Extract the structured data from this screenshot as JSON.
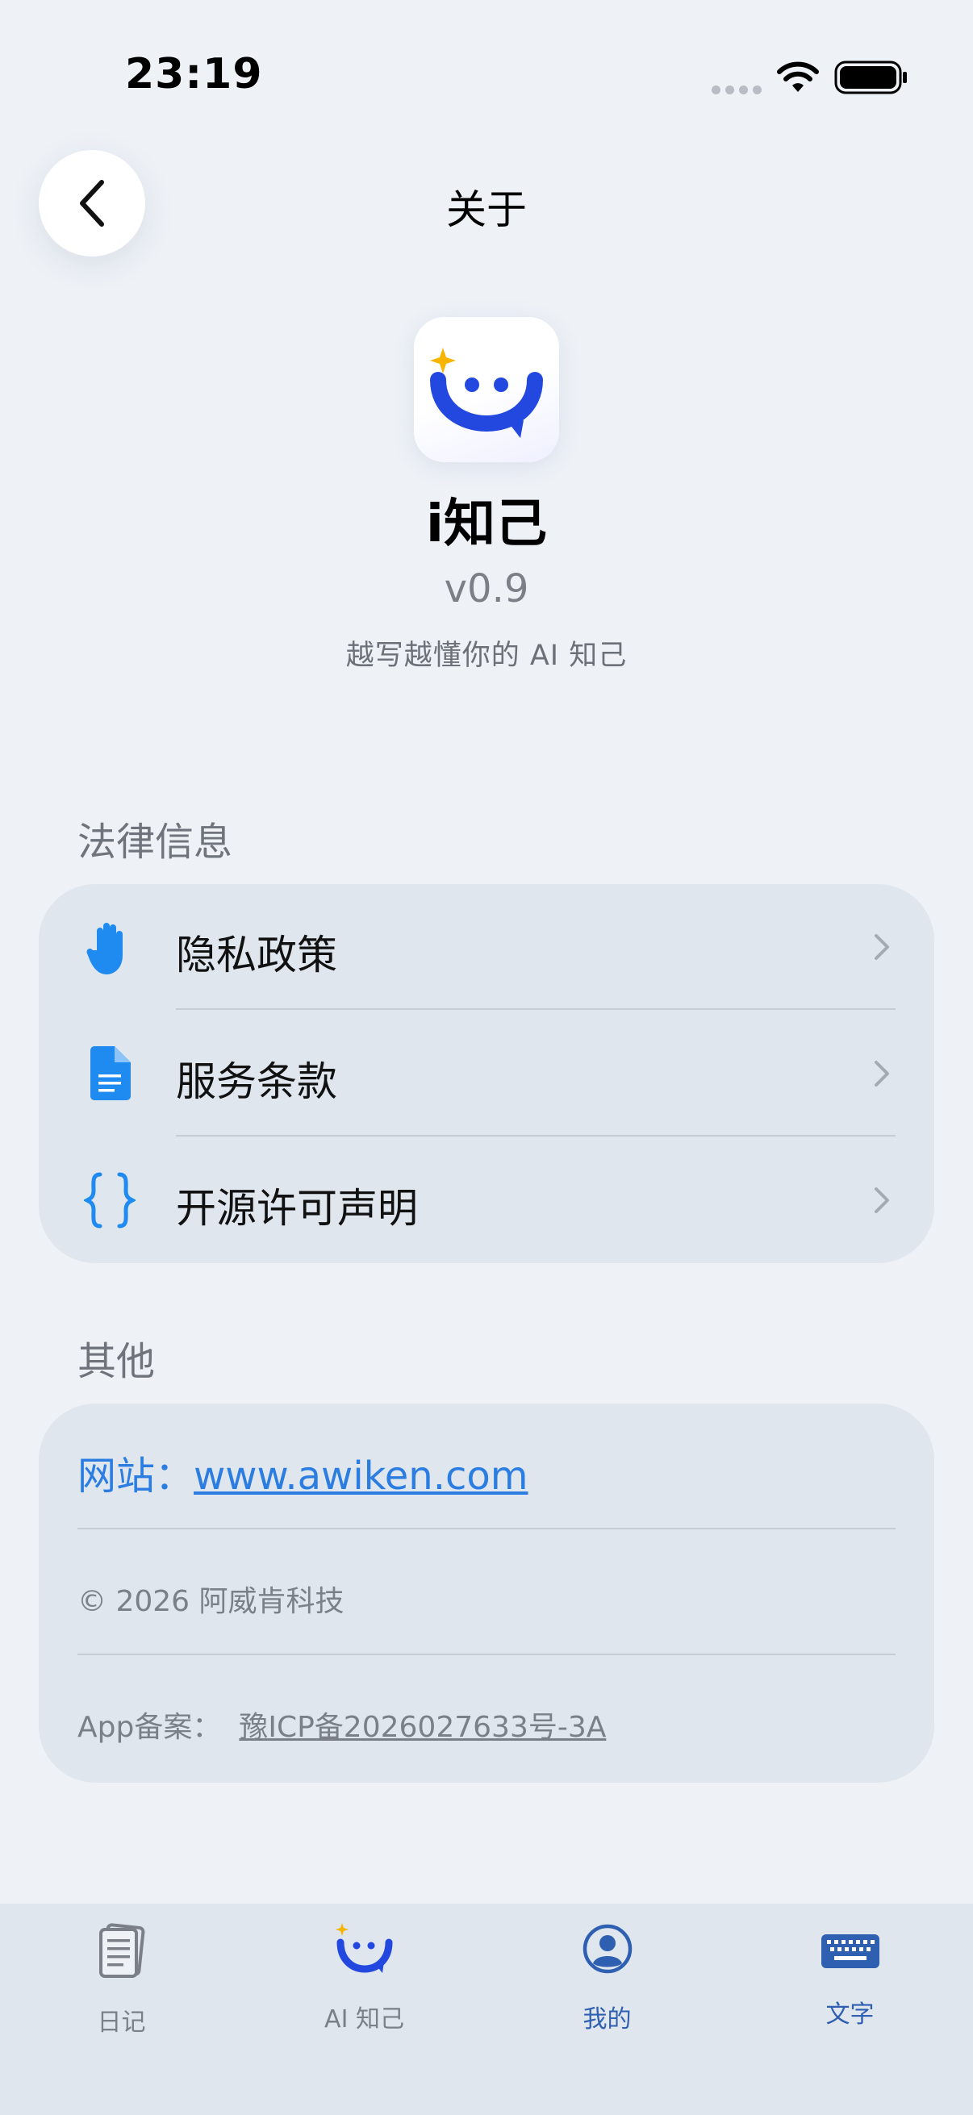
{
  "status_bar": {
    "time": "23:19"
  },
  "header": {
    "title": "关于"
  },
  "app": {
    "name": "i知己",
    "version": "v0.9",
    "tagline": "越写越懂你的 AI 知己"
  },
  "legal": {
    "title": "法律信息",
    "items": [
      {
        "label": "隐私政策",
        "icon": "hand-raised-icon"
      },
      {
        "label": "服务条款",
        "icon": "document-icon"
      },
      {
        "label": "开源许可声明",
        "icon": "curly-braces-icon"
      }
    ]
  },
  "other": {
    "title": "其他",
    "website_label": "网站：",
    "website_url": "www.awiken.com",
    "copyright": "© 2026 阿威肯科技",
    "icp_label": "App备案：",
    "icp_number": "豫ICP备2026027633号-3A"
  },
  "tabbar": {
    "tabs": [
      {
        "label": "日记",
        "icon": "diary-icon",
        "color": "#7b8088"
      },
      {
        "label": "AI 知己",
        "icon": "ai-smile-icon",
        "color": "#7b8088"
      },
      {
        "label": "我的",
        "icon": "profile-icon",
        "color": "#2f5fb0"
      },
      {
        "label": "文字",
        "icon": "keyboard-icon",
        "color": "#2f5fb0"
      }
    ]
  },
  "colors": {
    "accent": "#1f8bf0",
    "brand_blue": "#2348e0",
    "star": "#f7b500",
    "link": "#2b7de1"
  }
}
